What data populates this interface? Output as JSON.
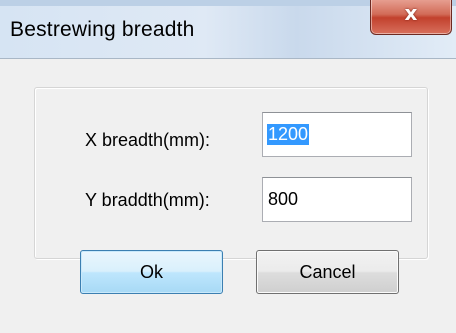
{
  "window": {
    "title": "Bestrewing breadth",
    "close_glyph": "x"
  },
  "form": {
    "x_label": "X breadth(mm):",
    "x_value": "1200",
    "y_label": "Y braddth(mm):",
    "y_value": "800"
  },
  "buttons": {
    "ok_label": "Ok",
    "cancel_label": "Cancel"
  }
}
